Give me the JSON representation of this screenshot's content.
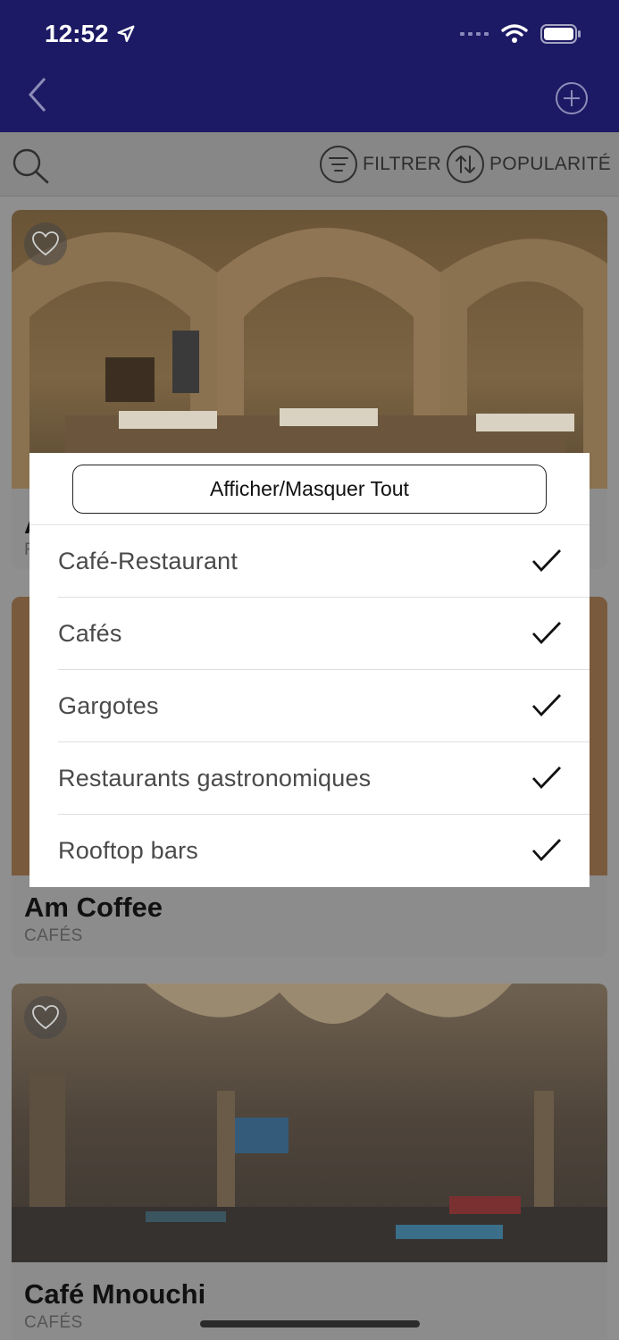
{
  "status_bar": {
    "time": "12:52"
  },
  "toolbar": {
    "filter_label": "FILTRER",
    "sort_label": "POPULARITÉ"
  },
  "cards": [
    {
      "title": "A",
      "subtitle": "R"
    },
    {
      "title": "Am Coffee",
      "subtitle": "CAFÉS"
    },
    {
      "title": "Café Mnouchi",
      "subtitle": "CAFÉS"
    }
  ],
  "modal": {
    "toggle_all_label": "Afficher/Masquer Tout",
    "options": [
      {
        "label": "Café-Restaurant",
        "checked": true
      },
      {
        "label": "Cafés",
        "checked": true
      },
      {
        "label": "Gargotes",
        "checked": true
      },
      {
        "label": "Restaurants gastronomiques",
        "checked": true
      },
      {
        "label": "Rooftop bars",
        "checked": true
      }
    ]
  },
  "colors": {
    "header": "#1c1a64",
    "overlay": "#8f8f8f",
    "modal": "#ffffff"
  },
  "icons": [
    "back-chevron-icon",
    "add-circle-icon",
    "search-icon",
    "filter-icon",
    "sort-icon",
    "heart-icon",
    "checkmark-icon",
    "location-arrow-icon",
    "wifi-icon",
    "battery-icon"
  ]
}
